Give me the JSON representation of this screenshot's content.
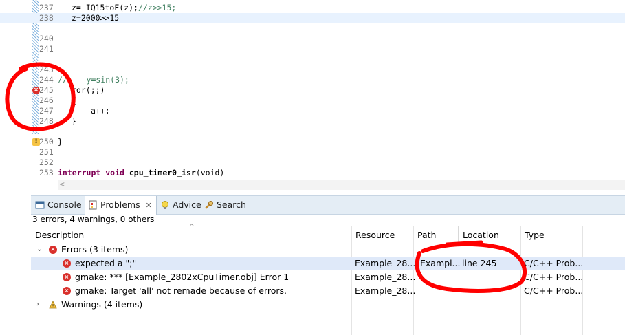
{
  "editor": {
    "lines": [
      {
        "no": "237",
        "text": "z=_IQ15toF(z);",
        "comment": "//z>>15;"
      },
      {
        "no": "238",
        "text": "z=2000>>15",
        "current": true
      },
      {
        "no": "240",
        "text": ""
      },
      {
        "no": "241",
        "text": ""
      },
      {
        "no": "243",
        "text": ""
      },
      {
        "no": "244",
        "text": "//    y=sin(3);"
      },
      {
        "no": "245",
        "text": "for(;;)",
        "marker": "error"
      },
      {
        "no": "246",
        "text": "{"
      },
      {
        "no": "247",
        "text": "a++;"
      },
      {
        "no": "248",
        "text": "}"
      },
      {
        "no": "250",
        "text": "}",
        "marker": "warning"
      },
      {
        "no": "251",
        "text": ""
      },
      {
        "no": "252",
        "text": ""
      },
      {
        "no": "253",
        "keyword": "interrupt void",
        "text": "cpu_timer0_isr",
        "tail": "(void)"
      }
    ]
  },
  "tabs": [
    {
      "label": "Console",
      "icon": "console-icon"
    },
    {
      "label": "Problems",
      "icon": "problems-icon",
      "active": true,
      "close": "✕"
    },
    {
      "label": "Advice",
      "icon": "lightbulb-icon"
    },
    {
      "label": "Search",
      "icon": "search-icon"
    }
  ],
  "problems": {
    "summary": "3 errors, 4 warnings, 0 others",
    "columns": [
      "Description",
      "Resource",
      "Path",
      "Location",
      "Type"
    ],
    "rows": [
      {
        "kind": "group",
        "severity": "error",
        "expanded": true,
        "description": "Errors (3 items)"
      },
      {
        "kind": "item",
        "severity": "error",
        "selected": true,
        "description": "expected a \";\"",
        "resource": "Example_28...",
        "path": "Exampl...",
        "location": "line 245",
        "type": "C/C++ Prob..."
      },
      {
        "kind": "item",
        "severity": "error",
        "description": "gmake: *** [Example_2802xCpuTimer.obj] Error 1",
        "resource": "Example_28...",
        "path": "",
        "location": "",
        "type": "C/C++ Prob..."
      },
      {
        "kind": "item",
        "severity": "error",
        "description": "gmake: Target 'all' not remade because of errors.",
        "resource": "Example_28...",
        "path": "",
        "location": "",
        "type": "C/C++ Prob..."
      },
      {
        "kind": "group",
        "severity": "warning",
        "expanded": false,
        "description": "Warnings (4 items)"
      }
    ]
  },
  "colors": {
    "error": "#d9302c",
    "warning": "#f6c445",
    "annotation": "#ff0000",
    "selection": "#dfe9f9"
  }
}
